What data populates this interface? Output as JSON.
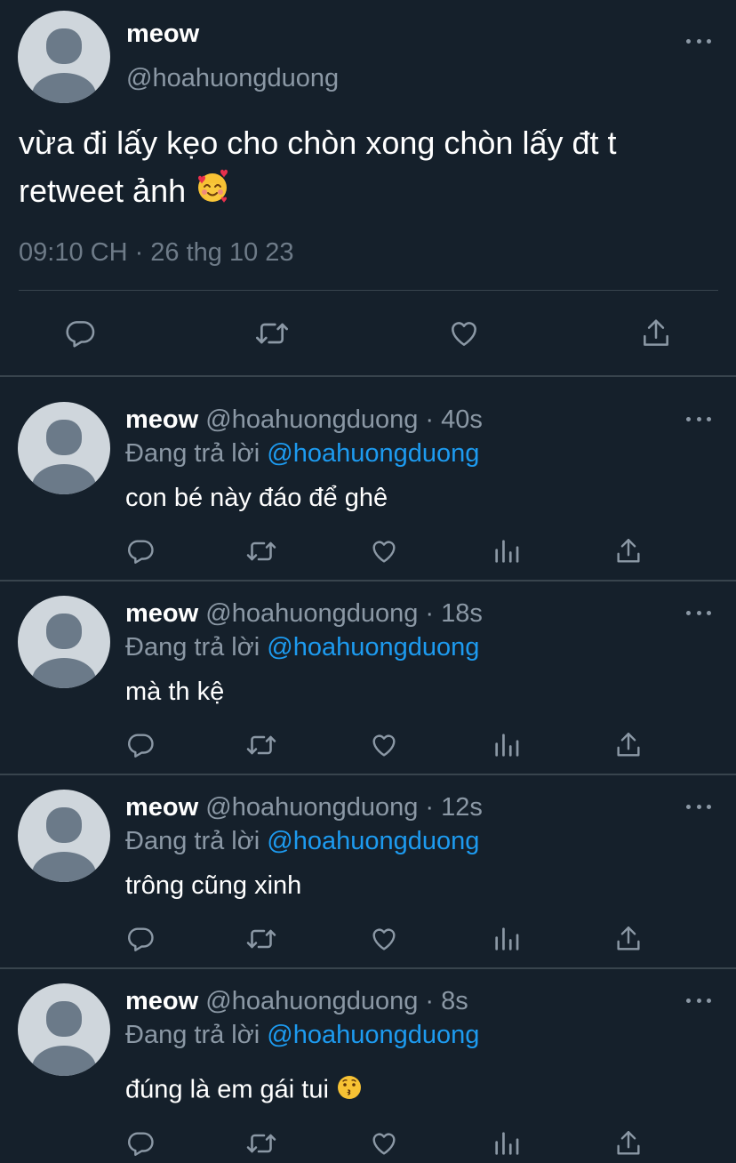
{
  "main_tweet": {
    "display_name": "meow",
    "handle": "@hoahuongduong",
    "text_line1": "vừa đi lấy kẹo cho chòn xong chòn lấy đt t",
    "text_line2": "retweet ảnh",
    "emoji": "smiling-face-with-hearts",
    "timestamp": "09:10 CH · 26 thg 10 23"
  },
  "replies": [
    {
      "display_name": "meow",
      "handle": "@hoahuongduong",
      "time": "· 40s",
      "replying_prefix": "Đang trả lời",
      "replying_to": "@hoahuongduong",
      "text": "con bé này đáo để ghê"
    },
    {
      "display_name": "meow",
      "handle": "@hoahuongduong",
      "time": "· 18s",
      "replying_prefix": "Đang trả lời",
      "replying_to": "@hoahuongduong",
      "text": "mà th kệ"
    },
    {
      "display_name": "meow",
      "handle": "@hoahuongduong",
      "time": "· 12s",
      "replying_prefix": "Đang trả lời",
      "replying_to": "@hoahuongduong",
      "text": "trông cũng xinh"
    },
    {
      "display_name": "meow",
      "handle": "@hoahuongduong",
      "time": "· 8s",
      "replying_prefix": "Đang trả lời",
      "replying_to": "@hoahuongduong",
      "text": "đúng là em gái tui",
      "emoji": "kissing-face"
    }
  ],
  "colors": {
    "background": "#15202b",
    "primary_text": "#ffffff",
    "secondary_text": "#8b98a5",
    "mention": "#1d9bf0",
    "divider": "#38444d"
  },
  "icons": [
    "reply-icon",
    "retweet-icon",
    "like-icon",
    "views-icon",
    "share-icon",
    "more-icon",
    "avatar-placeholder-icon"
  ]
}
